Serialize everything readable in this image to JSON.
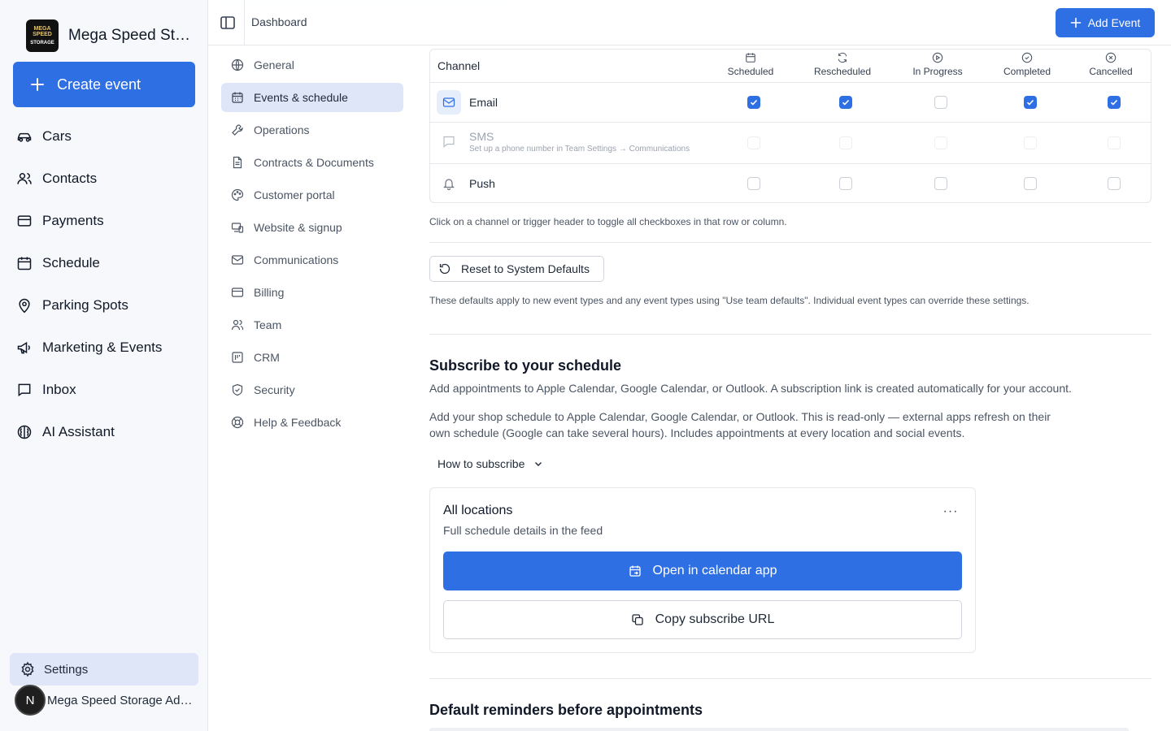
{
  "sidebar": {
    "brand_name": "Mega Speed Storage",
    "brand_logo_text": [
      "MEGA SPEED",
      "STORAGE"
    ],
    "create_label": "Create event",
    "items": [
      {
        "label": "Cars",
        "icon": "car-icon"
      },
      {
        "label": "Contacts",
        "icon": "users-icon"
      },
      {
        "label": "Payments",
        "icon": "credit-card-icon"
      },
      {
        "label": "Schedule",
        "icon": "calendar-icon"
      },
      {
        "label": "Parking Spots",
        "icon": "map-pin-icon"
      },
      {
        "label": "Marketing & Events",
        "icon": "megaphone-icon"
      },
      {
        "label": "Inbox",
        "icon": "inbox-icon"
      },
      {
        "label": "AI Assistant",
        "icon": "brain-icon"
      }
    ],
    "settings_label": "Settings",
    "account_initial": "N",
    "account_name": "Mega Speed Storage Admin"
  },
  "topbar": {
    "breadcrumb": "Dashboard",
    "add_event_label": "Add Event"
  },
  "subnav": {
    "items": [
      {
        "label": "General",
        "icon": "globe-icon",
        "active": false
      },
      {
        "label": "Events & schedule",
        "icon": "calendar-icon",
        "active": true
      },
      {
        "label": "Operations",
        "icon": "wrench-icon",
        "active": false
      },
      {
        "label": "Contracts & Documents",
        "icon": "file-icon",
        "active": false
      },
      {
        "label": "Customer portal",
        "icon": "palette-icon",
        "active": false
      },
      {
        "label": "Website & signup",
        "icon": "devices-icon",
        "active": false
      },
      {
        "label": "Communications",
        "icon": "mail-icon",
        "active": false
      },
      {
        "label": "Billing",
        "icon": "credit-card-icon",
        "active": false
      },
      {
        "label": "Team",
        "icon": "users-icon",
        "active": false
      },
      {
        "label": "CRM",
        "icon": "crm-icon",
        "active": false
      },
      {
        "label": "Security",
        "icon": "shield-icon",
        "active": false
      },
      {
        "label": "Help & Feedback",
        "icon": "lifebuoy-icon",
        "active": false
      }
    ]
  },
  "notifications": {
    "channel_header": "Channel",
    "triggers": [
      {
        "label": "Scheduled",
        "icon": "calendar-icon"
      },
      {
        "label": "Rescheduled",
        "icon": "refresh-icon"
      },
      {
        "label": "In Progress",
        "icon": "play-circle-icon"
      },
      {
        "label": "Completed",
        "icon": "check-circle-icon"
      },
      {
        "label": "Cancelled",
        "icon": "x-circle-icon"
      }
    ],
    "channels": [
      {
        "name": "Email",
        "icon": "mail-icon",
        "disabled": false,
        "checks": [
          true,
          true,
          false,
          true,
          true
        ]
      },
      {
        "name": "SMS",
        "icon": "message-icon",
        "disabled": true,
        "note": "Set up a phone number in Team Settings → Communications",
        "checks": [
          false,
          false,
          false,
          false,
          false
        ]
      },
      {
        "name": "Push",
        "icon": "bell-icon",
        "disabled": false,
        "checks": [
          false,
          false,
          false,
          false,
          false
        ]
      }
    ],
    "hint": "Click on a channel or trigger header to toggle all checkboxes in that row or column.",
    "reset_label": "Reset to System Defaults",
    "defaults_note": "These defaults apply to new event types and any event types using \"Use team defaults\". Individual event types can override these settings."
  },
  "subscribe": {
    "title": "Subscribe to your schedule",
    "subtitle": "Add appointments to Apple Calendar, Google Calendar, or Outlook. A subscription link is created automatically for your account.",
    "paragraph": "Add your shop schedule to Apple Calendar, Google Calendar, or Outlook. This is read-only — external apps refresh on their own schedule (Google can take several hours). Includes appointments at every location and social events.",
    "how_label": "How to subscribe",
    "card": {
      "title": "All locations",
      "subtitle": "Full schedule details in the feed",
      "more_label": "···",
      "open_label": "Open in calendar app",
      "copy_label": "Copy subscribe URL"
    }
  },
  "reminders": {
    "title": "Default reminders before appointments"
  },
  "colors": {
    "accent": "#2f6fe4",
    "active_bg": "#dfe6f7",
    "sidebar_bg": "#f6f8fb"
  }
}
